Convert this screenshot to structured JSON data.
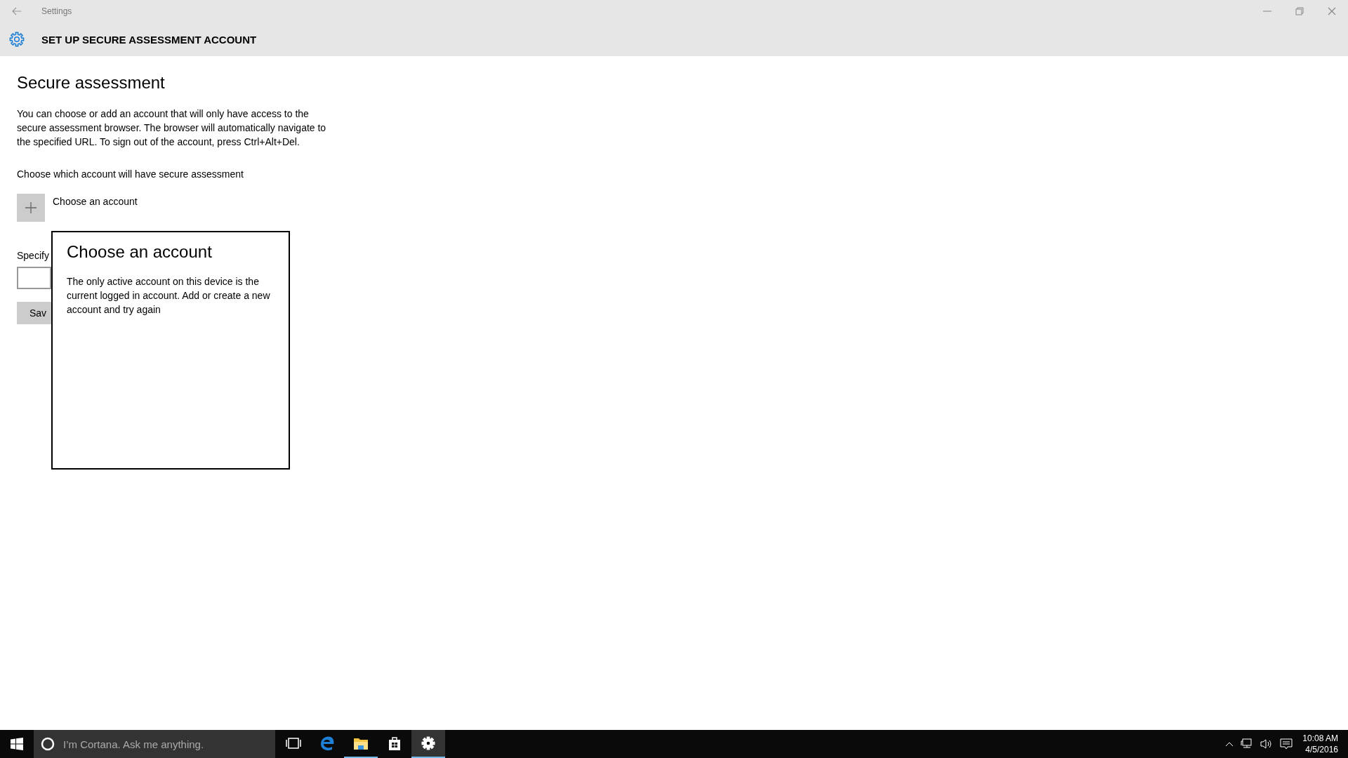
{
  "window": {
    "app_name": "Settings",
    "page_title": "SET UP SECURE ASSESSMENT ACCOUNT"
  },
  "content": {
    "heading": "Secure assessment",
    "description": "You can choose or add an account that will only have access to the secure assessment browser. The browser will automatically navigate to the specified URL. To sign out of the account, press Ctrl+Alt+Del.",
    "account_prompt": "Choose which account will have secure assessment",
    "choose_account_label": "Choose an account",
    "url_label": "Specify",
    "save_button": "Sav"
  },
  "dialog": {
    "title": "Choose an account",
    "message": "The only active account on this device is the current logged in account. Add or create a new account and try again"
  },
  "taskbar": {
    "search": {
      "placeholder": "I’m Cortana. Ask me anything."
    },
    "apps": [
      {
        "kind": "taskview",
        "running": false,
        "active": false
      },
      {
        "kind": "browser",
        "running": false,
        "active": false
      },
      {
        "kind": "folder",
        "running": true,
        "active": false
      },
      {
        "kind": "store",
        "running": false,
        "active": false
      },
      {
        "kind": "settings",
        "running": true,
        "active": true
      }
    ],
    "clock": {
      "time": "10:08 AM",
      "date": "4/5/2016"
    }
  }
}
